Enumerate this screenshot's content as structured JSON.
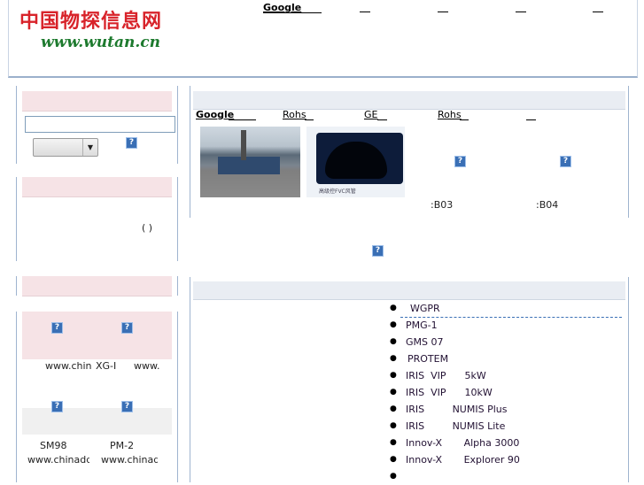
{
  "header": {
    "logo_cn": "中国物探信息网",
    "logo_en": "www.wutan.cn",
    "top_links": [
      "Google",
      "",
      "",
      "",
      ""
    ]
  },
  "sidebar": {
    "search_box": {
      "value": "",
      "select_value": ""
    },
    "box2": {
      "text": "( )"
    },
    "box4": {
      "row1_labels": [
        "www.chin",
        "XG-I",
        "www."
      ],
      "row2_labels": [
        "SM98",
        "PM-2"
      ],
      "row2_urls": [
        "www.chinaddc",
        "www.chinad"
      ]
    }
  },
  "main": {
    "links": [
      "Google",
      "Rohs",
      "GE",
      "Rohs",
      ""
    ],
    "photo_caption": "高级控FVC风管",
    "codes": [
      ":B03",
      ":B04"
    ],
    "products": [
      "WGPR",
      "PMG-1",
      "GMS 07",
      "PROTEM",
      "IRIS  VIP      5kW",
      "IRIS  VIP      10kW",
      "IRIS         NUMIS Plus",
      "IRIS         NUMIS Lite",
      "Innov-X       Alpha 3000",
      "Innov-X       Explorer 90",
      ""
    ]
  },
  "colors": {
    "border": "#9fb4cf",
    "pink_header": "#f6e3e6",
    "blue_header": "#e9edf3",
    "logo_red": "#d8232a",
    "logo_green": "#1d7a2e",
    "icon_blue": "#3a6fb5"
  },
  "icons": [
    "question-icon"
  ]
}
